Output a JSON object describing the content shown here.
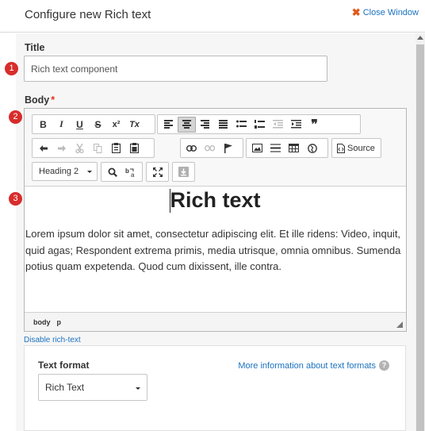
{
  "header": {
    "title": "Configure new Rich text",
    "close_label": "Close Window"
  },
  "badges": [
    "1",
    "2",
    "3"
  ],
  "title_field": {
    "label": "Title",
    "value": "Rich text component"
  },
  "body_field": {
    "label": "Body",
    "required_marker": "*"
  },
  "toolbar": {
    "source_label": "Source",
    "format_combo": "Heading 2",
    "icons": {
      "row1": [
        "bold-icon",
        "italic-icon",
        "underline-icon",
        "strikethrough-icon",
        "superscript-icon",
        "remove-format-icon",
        "align-left-icon",
        "align-center-icon",
        "align-right-icon",
        "align-justify-icon",
        "bulleted-list-icon",
        "numbered-list-icon",
        "outdent-icon",
        "indent-icon",
        "blockquote-icon"
      ],
      "row2": [
        "undo-icon",
        "redo-icon",
        "cut-icon",
        "copy-icon",
        "paste-icon",
        "paste-text-icon",
        "link-icon",
        "unlink-icon",
        "anchor-icon",
        "image-icon",
        "horizontal-rule-icon",
        "table-icon",
        "iframe-icon",
        "source-icon"
      ],
      "row3": [
        "find-icon",
        "replace-icon",
        "maximize-icon",
        "template-icon"
      ]
    },
    "glyphs": {
      "bold": "B",
      "italic": "I",
      "underline": "U",
      "strike": "S",
      "superscript": "x²",
      "remove_format": "Tx",
      "blockquote": "❞"
    }
  },
  "content": {
    "heading": "Rich text",
    "paragraph": "Lorem ipsum dolor sit amet, consectetur adipiscing elit. Et ille ridens: Video, inquit, quid agas; Respondent extrema primis, media utrisque, omnia omnibus. Sumenda potius quam expetenda. Quod cum dixissent, ille contra."
  },
  "status_bar": {
    "path": [
      "body",
      "p"
    ]
  },
  "disable_link": "Disable rich-text",
  "text_format": {
    "label": "Text format",
    "more_info": "More information about text formats",
    "help_glyph": "?",
    "selected": "Rich Text"
  },
  "colors": {
    "link": "#1a72c0",
    "badge": "#d82c2c",
    "close_x": "#e05a1c",
    "required": "#e5301c"
  }
}
